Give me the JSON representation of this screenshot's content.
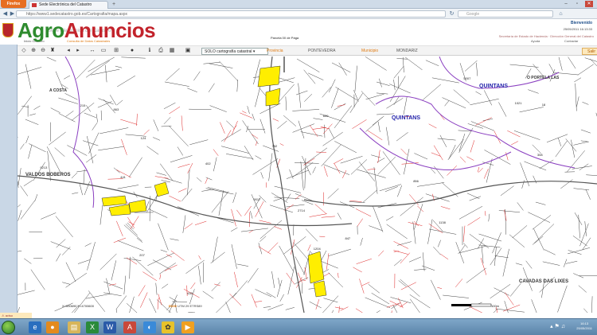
{
  "browser": {
    "firefox_label": "Firefox",
    "tab_title": "Sede Electrónica del Catastro",
    "new_tab": "+",
    "url": "https://www1.sedecatastro.gob.es/Cartografia/mapa.aspx",
    "search_placeholder": "Google",
    "window_min": "–",
    "window_max": "▫",
    "window_close": "✕"
  },
  "site": {
    "logo_part1": "Agro",
    "logo_part2": "Anuncios",
    "sede_title": "Sede Electrónica del Catastro",
    "user": "Bienvenido",
    "date": "25/05/2011 16:13:33",
    "ministry_1": "Secretaría de Estado de Hacienda",
    "ministry_2": "Dirección General del Catastro",
    "help": "Ayuda",
    "contact": "Contactar",
    "nav_home": "Inicio Catastro",
    "nav_consulta": "Consulta de Datos Catastrales"
  },
  "toolbar": {
    "layer_select": "SOLO cartografía catastral",
    "province": "Provincia",
    "province_value": "PONTEVEDRA",
    "municipio": "Municipio",
    "municipio_value": "MONDARIZ",
    "salir": "Salir"
  },
  "map": {
    "parcela_label": "Parcela 00 de Pága",
    "labels": [
      {
        "text": "QUINTANS",
        "color": "#2222aa"
      },
      {
        "text": "QUINTANS",
        "color": "#2222aa"
      },
      {
        "text": "VALDOS BOBEROS",
        "color": "#333333"
      },
      {
        "text": "CAVADAS DAS LIXES",
        "color": "#333333"
      },
      {
        "text": "A COSTA",
        "color": "#333333"
      },
      {
        "text": "O PORTELA LAS",
        "color": "#333333"
      }
    ],
    "parcels": [
      "839",
      "847",
      "856",
      "863",
      "1021",
      "215",
      "207",
      "1138",
      "5007",
      "9213",
      "2714",
      "441",
      "308",
      "752",
      "1204",
      "633",
      "18",
      "124",
      "9017",
      "402"
    ]
  },
  "status": {
    "coords": "X=590690 Y=4700600",
    "utm_label": "ED50",
    "utm": "UTM 29 ETRS89",
    "scale": "100m"
  },
  "taskbar": {
    "clock_time": "16:13",
    "clock_date": "25/05/2011",
    "notif": "⚠ aviso"
  },
  "colors": {
    "accent": "#e07b12",
    "parcel_lines": "#333333",
    "red_lines": "#d22222",
    "purple_boundary": "#8a3fc0",
    "highlight": "#ffee00"
  }
}
